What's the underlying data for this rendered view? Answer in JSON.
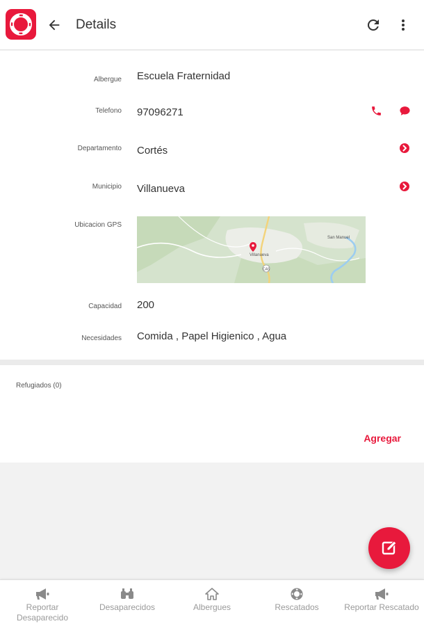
{
  "appbar": {
    "title": "Details",
    "icons": {
      "logo": "lifebuoy-logo",
      "back": "arrow-back-icon",
      "refresh": "refresh-icon",
      "more": "more-vert-icon"
    }
  },
  "details": {
    "albergue": {
      "label": "Albergue",
      "value": "Escuela Fraternidad"
    },
    "telefono": {
      "label": "Telefono",
      "value": "97096271"
    },
    "departamento": {
      "label": "Departamento",
      "value": "Cortés"
    },
    "municipio": {
      "label": "Municipio",
      "value": "Villanueva"
    },
    "gps": {
      "label": "Ubicacion GPS",
      "map_labels": {
        "town": "Villanueva",
        "place": "San Manuel",
        "route": "CA5"
      }
    },
    "capacidad": {
      "label": "Capacidad",
      "value": "200"
    },
    "necesidades": {
      "label": "Necesidades",
      "value": "Comida , Papel Higienico , Agua"
    }
  },
  "refugiados": {
    "title": "Refugiados (0)",
    "add_label": "Agregar"
  },
  "bottom_nav": [
    {
      "label": "Reportar Desaparecido",
      "icon": "megaphone-icon"
    },
    {
      "label": "Desaparecidos",
      "icon": "binoculars-icon"
    },
    {
      "label": "Albergues",
      "icon": "home-icon"
    },
    {
      "label": "Rescatados",
      "icon": "lifebuoy-icon"
    },
    {
      "label": "Reportar Rescatado",
      "icon": "megaphone-icon"
    }
  ],
  "colors": {
    "accent": "#e8193c",
    "text": "#333333",
    "muted": "#9a9a9a"
  }
}
